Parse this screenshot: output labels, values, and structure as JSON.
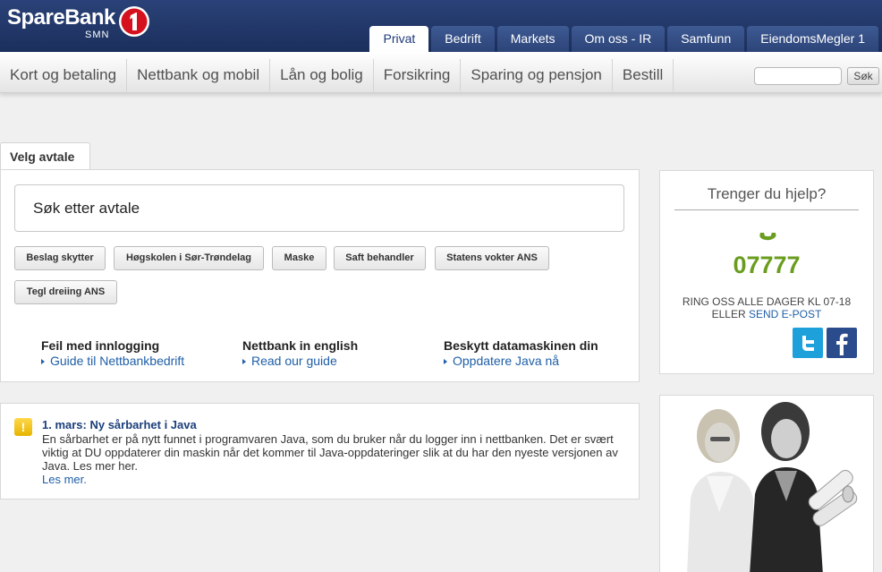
{
  "brand": {
    "name": "SpareBank",
    "sub": "SMN",
    "badge": "1"
  },
  "top_tabs": [
    {
      "label": "Privat",
      "active": true
    },
    {
      "label": "Bedrift"
    },
    {
      "label": "Markets"
    },
    {
      "label": "Om oss - IR"
    },
    {
      "label": "Samfunn"
    },
    {
      "label": "EiendomsMegler 1"
    }
  ],
  "main_nav": [
    "Kort og betaling",
    "Nettbank og mobil",
    "Lån og bolig",
    "Forsikring",
    "Sparing og pensjon",
    "Bestill"
  ],
  "search": {
    "value": "",
    "button": "Søk"
  },
  "velg_avtale": {
    "tab_label": "Velg avtale",
    "search_placeholder": "Søk etter avtale",
    "chips": [
      "Beslag skytter",
      "Høgskolen i Sør-Trøndelag",
      "Maske",
      "Saft behandler",
      "Statens vokter ANS",
      "Tegl dreiing ANS"
    ]
  },
  "info_links": [
    {
      "title": "Feil med innlogging",
      "link": "Guide til Nettbankbedrift"
    },
    {
      "title": "Nettbank in english",
      "link": "Read our guide"
    },
    {
      "title": "Beskytt datamaskinen din",
      "link": "Oppdatere Java nå"
    }
  ],
  "notice": {
    "icon": "!",
    "title": "1. mars: Ny sårbarhet i Java",
    "body": "En sårbarhet er på nytt funnet i programvaren Java, som du bruker når du logger inn i nettbanken. Det er svært viktig at DU oppdaterer din maskin når det kommer til Java-oppdateringer slik at du har den nyeste versjonen av Java. Les mer her.",
    "link": "Les mer."
  },
  "help": {
    "title": "Trenger du hjelp?",
    "phone": "07777",
    "hours_line1": "RING OSS ALLE DAGER KL 07-18",
    "hours_line2_prefix": "ELLER",
    "epost": "SEND E-POST"
  },
  "colors": {
    "brand_navy": "#1b2f5c",
    "link": "#1f5fa8",
    "phone_green": "#6a9d1f",
    "logo_red": "#d4111d",
    "twitter": "#1ea0db",
    "facebook": "#2b4c8c"
  },
  "icons": [
    "sparebank-logo-icon",
    "phone-icon",
    "twitter-icon",
    "facebook-icon",
    "warning-icon",
    "arrow-right-icon"
  ]
}
